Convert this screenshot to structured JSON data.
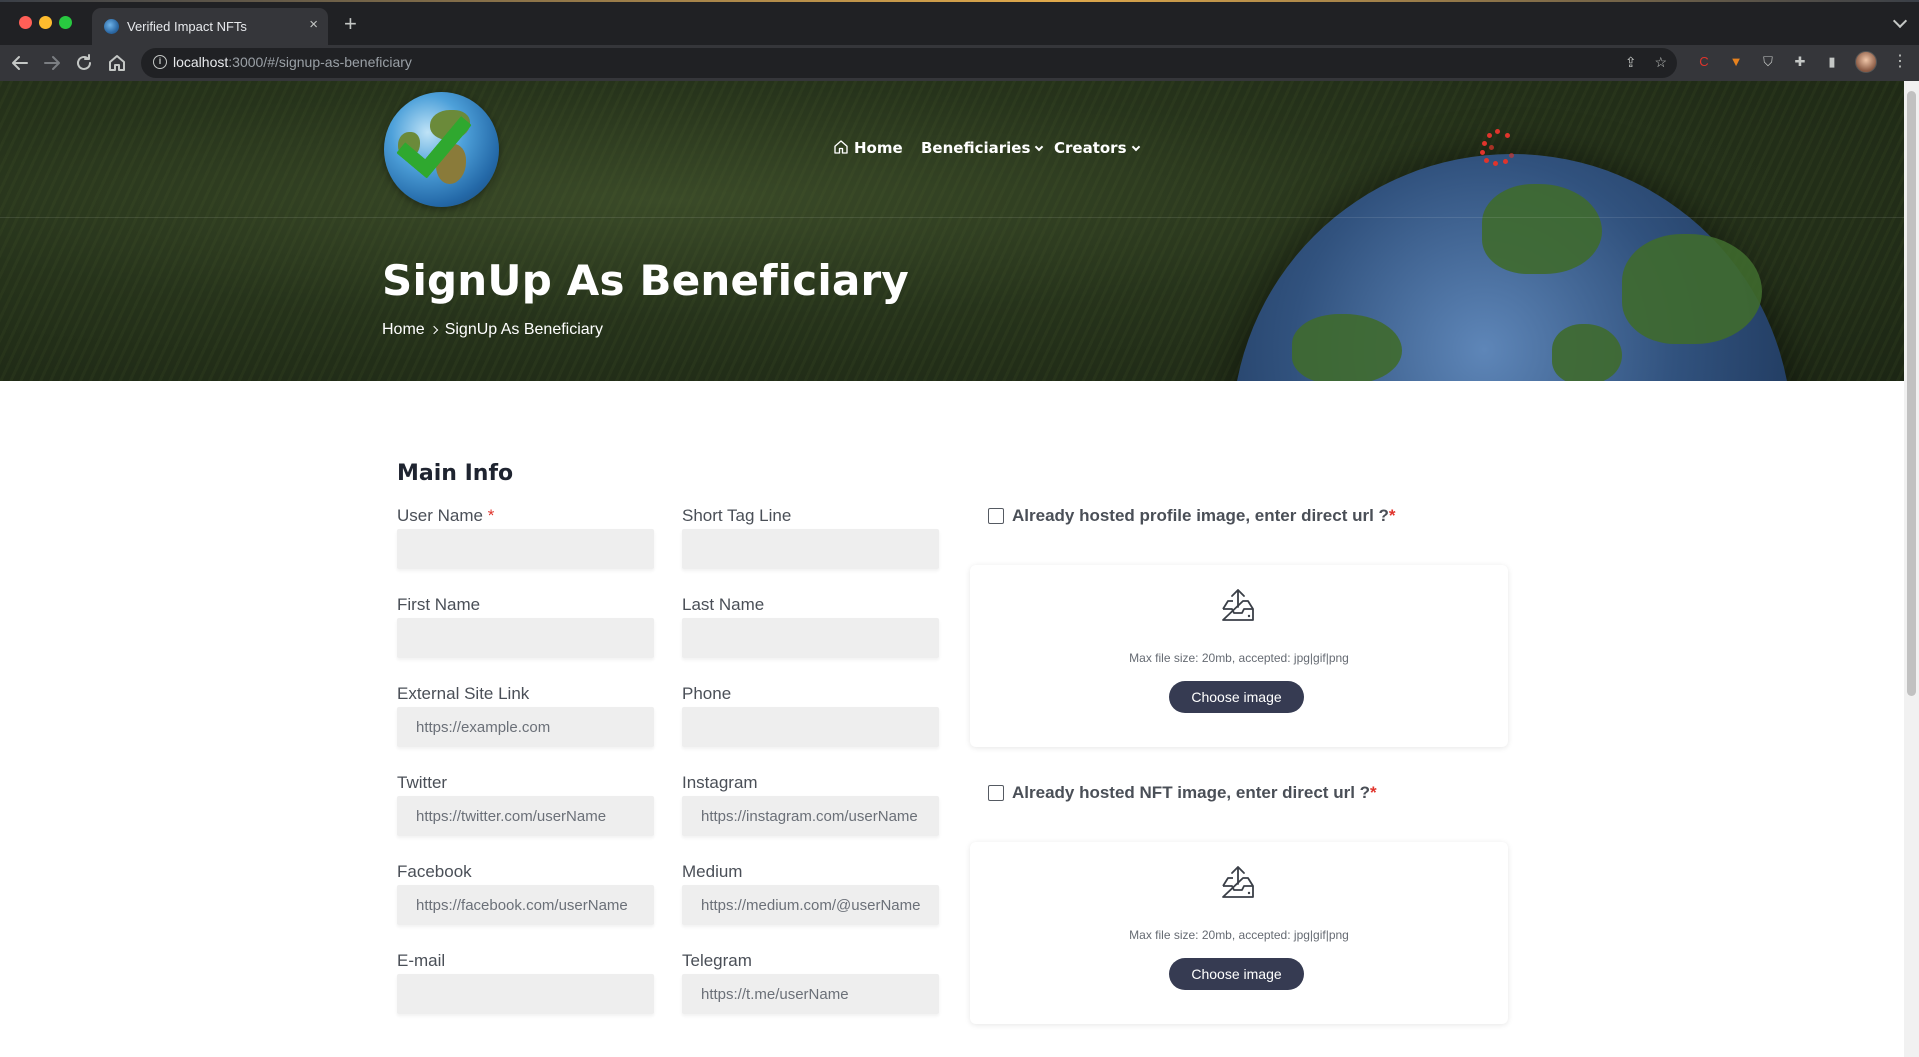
{
  "browser": {
    "tab_title": "Verified Impact NFTs",
    "tab_close": "×",
    "new_tab": "+",
    "url_host": "localhost",
    "url_rest": ":3000/#/signup-as-beneficiary"
  },
  "nav": {
    "home": "Home",
    "beneficiaries": "Beneficiaries",
    "creators": "Creators"
  },
  "page": {
    "title": "SignUp As Beneficiary",
    "breadcrumb_home": "Home",
    "breadcrumb_current": "SignUp As Beneficiary"
  },
  "form": {
    "section_title": "Main Info",
    "required_mark": "*",
    "fields": {
      "username": {
        "label": "User Name",
        "placeholder": ""
      },
      "tagline": {
        "label": "Short Tag Line",
        "placeholder": ""
      },
      "first_name": {
        "label": "First Name",
        "placeholder": ""
      },
      "last_name": {
        "label": "Last Name",
        "placeholder": ""
      },
      "external_site": {
        "label": "External Site Link",
        "placeholder": "https://example.com"
      },
      "phone": {
        "label": "Phone",
        "placeholder": ""
      },
      "twitter": {
        "label": "Twitter",
        "placeholder": "https://twitter.com/userName"
      },
      "instagram": {
        "label": "Instagram",
        "placeholder": "https://instagram.com/userName"
      },
      "facebook": {
        "label": "Facebook",
        "placeholder": "https://facebook.com/userName"
      },
      "medium": {
        "label": "Medium",
        "placeholder": "https://medium.com/@userName"
      },
      "email": {
        "label": "E-mail",
        "placeholder": ""
      },
      "telegram": {
        "label": "Telegram",
        "placeholder": "https://t.me/userName"
      }
    },
    "profile_image": {
      "hosted_label": "Already hosted profile image, enter direct url ?",
      "hint": "Max file size: 20mb, accepted: jpg|gif|png",
      "button": "Choose image"
    },
    "nft_image": {
      "hosted_label": "Already hosted NFT image, enter direct url ?",
      "hint": "Max file size: 20mb, accepted: jpg|gif|png",
      "button": "Choose image"
    }
  },
  "icons": {
    "back": "arrow-left-icon",
    "forward": "arrow-right-icon",
    "reload": "reload-icon",
    "home": "home-icon",
    "site_info": "info-icon",
    "share": "share-icon",
    "bookmark": "star-icon",
    "extensions": "puzzle-icon",
    "upload": "inbox-upload-icon",
    "loader": "spinner-icon"
  },
  "colors": {
    "accent_dark": "#363b52",
    "required": "#e0342c",
    "input_bg": "#eeeeee",
    "hero_green": "#26331b"
  }
}
